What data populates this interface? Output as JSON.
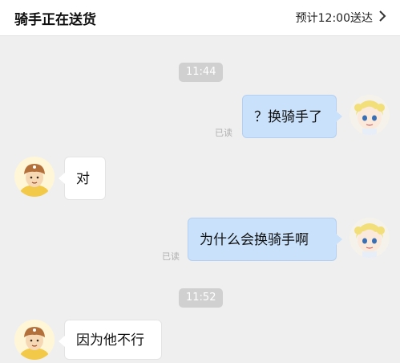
{
  "header": {
    "title": "骑手正在送货",
    "eta": "预计12:00送达",
    "chevron_icon": "chevron-right-icon"
  },
  "messages": {
    "time_1": "11:44",
    "msg_1": "？换骑手了",
    "read_1": "已读",
    "msg_2": "对",
    "msg_3": "为什么会换骑手啊",
    "read_3": "已读",
    "time_2": "11:52",
    "msg_4": "因为他不行"
  },
  "colors": {
    "background": "#efefef",
    "right_bubble": "#c9e1fb",
    "left_bubble": "#ffffff",
    "time_chip": "#d0d0d0",
    "rider_helmet": "#b4703a",
    "rider_vest": "#f3c94a"
  },
  "avatars": {
    "user": "anime-girl-avatar",
    "rider": "delivery-rider-avatar"
  }
}
